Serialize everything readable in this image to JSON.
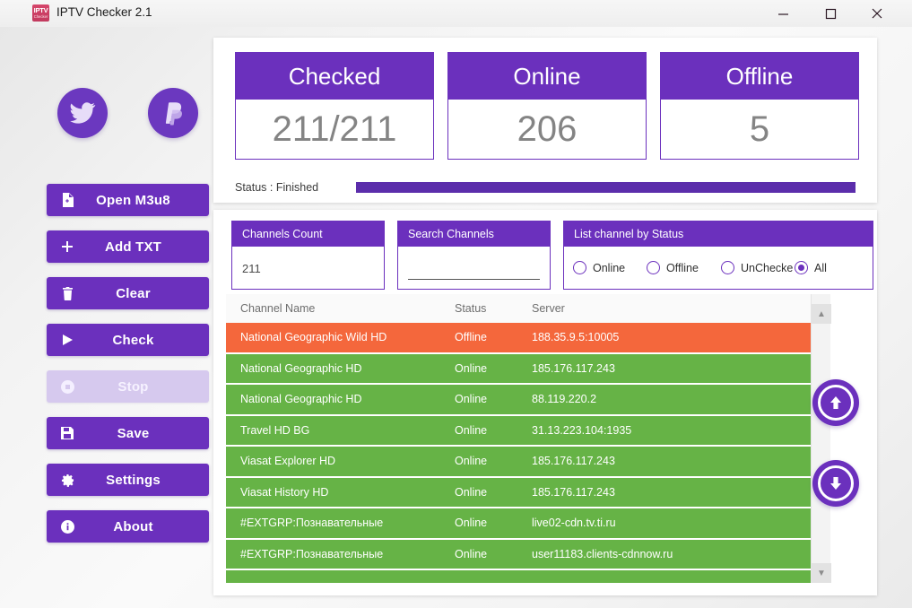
{
  "window": {
    "title": "IPTV Checker 2.1",
    "icon_line1": "IPTV",
    "icon_line2": "Checker",
    "minimize_label": "minimize",
    "maximize_label": "maximize",
    "close_label": "close"
  },
  "sidebar": {
    "social": [
      {
        "name": "twitter",
        "label": "Twitter"
      },
      {
        "name": "paypal",
        "label": "PayPal"
      }
    ],
    "buttons": [
      {
        "label": "Open M3u8",
        "icon": "file-icon",
        "disabled": false
      },
      {
        "label": "Add TXT",
        "icon": "plus-icon",
        "disabled": false
      },
      {
        "label": "Clear",
        "icon": "trash-icon",
        "disabled": false
      },
      {
        "label": "Check",
        "icon": "play-icon",
        "disabled": false
      },
      {
        "label": "Stop",
        "icon": "stop-circle-icon",
        "disabled": true
      },
      {
        "label": "Save",
        "icon": "floppy-icon",
        "disabled": false
      },
      {
        "label": "Settings",
        "icon": "gear-icon",
        "disabled": false
      },
      {
        "label": "About",
        "icon": "info-icon",
        "disabled": false
      }
    ]
  },
  "stats": {
    "cards": [
      {
        "title": "Checked",
        "value": "211/211"
      },
      {
        "title": "Online",
        "value": "206"
      },
      {
        "title": "Offline",
        "value": "5"
      }
    ],
    "status_label": "Status : Finished",
    "progress_percent": 100
  },
  "filters": {
    "channels_count": {
      "title": "Channels Count",
      "value": "211"
    },
    "search": {
      "title": "Search Channels",
      "value": "",
      "placeholder": ""
    },
    "status_filter": {
      "title": "List channel by Status",
      "options": [
        {
          "label": "Online",
          "selected": false
        },
        {
          "label": "Offline",
          "selected": false
        },
        {
          "label": "UnChecked",
          "selected": false
        },
        {
          "label": "All",
          "selected": true
        }
      ]
    }
  },
  "table": {
    "columns": [
      "Channel Name",
      "Status",
      "Server"
    ],
    "rows": [
      {
        "name": "National Geographic Wild HD",
        "status": "Offline",
        "server": "188.35.9.5:10005",
        "state": "offline"
      },
      {
        "name": "National Geographic HD",
        "status": "Online",
        "server": "185.176.117.243",
        "state": "online"
      },
      {
        "name": "National Geographic HD",
        "status": "Online",
        "server": "88.119.220.2",
        "state": "online"
      },
      {
        "name": "Travel HD BG",
        "status": "Online",
        "server": "31.13.223.104:1935",
        "state": "online"
      },
      {
        "name": "Viasat Explorer HD",
        "status": "Online",
        "server": "185.176.117.243",
        "state": "online"
      },
      {
        "name": "Viasat History HD",
        "status": "Online",
        "server": "185.176.117.243",
        "state": "online"
      },
      {
        "name": "#EXTGRP:Познавательные",
        "status": "Online",
        "server": "live02-cdn.tv.ti.ru",
        "state": "online"
      },
      {
        "name": "#EXTGRP:Познавательные",
        "status": "Online",
        "server": "user11183.clients-cdnnow.ru",
        "state": "online"
      }
    ]
  },
  "scroll": {
    "up_label": "Scroll Up",
    "down_label": "Scroll Down"
  },
  "colors": {
    "purple": "#6b30bd",
    "purple_dark": "#5b2dab",
    "purple_disabled": "#d6c9ee",
    "online_green": "#66b346",
    "offline_orange": "#f4673c",
    "value_gray": "#848484"
  }
}
